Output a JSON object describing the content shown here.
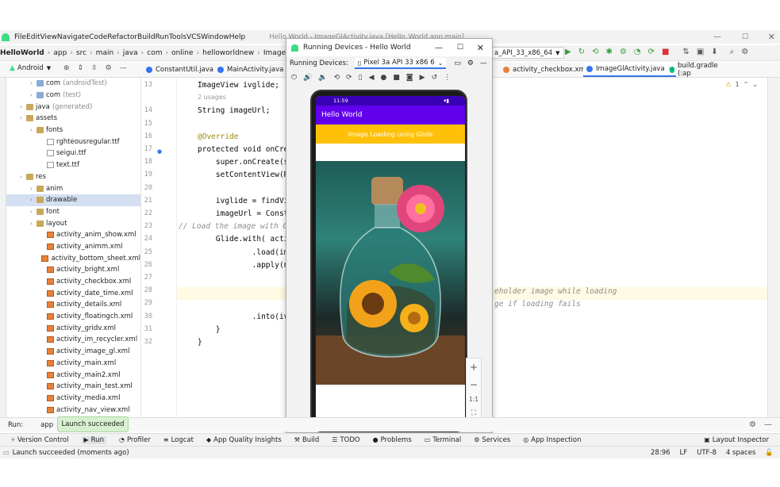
{
  "menu": [
    "File",
    "Edit",
    "View",
    "Navigate",
    "Code",
    "Refactor",
    "Build",
    "Run",
    "Tools",
    "VCS",
    "Window",
    "Help"
  ],
  "window_title": "Hello World - ImageGlActivity.java [Hello_World.app.main]",
  "breadcrumb": [
    "HelloWorld",
    "app",
    "src",
    "main",
    "java",
    "com",
    "online",
    "helloworldnew",
    "ImageGlActi"
  ],
  "device_selector": "a_API_33_x86_64",
  "project_view": "Android",
  "editor_tabs": [
    {
      "label": "ConstantUtil.java"
    },
    {
      "label": "MainActivity.java"
    },
    {
      "label": "activity_checkbox.xml"
    },
    {
      "label": "ImageGlActivity.java",
      "active": true
    },
    {
      "label": "build.gradle (:ap"
    }
  ],
  "warning_count": "1",
  "tree": [
    {
      "label": "com",
      "suffix": "(androidTest)",
      "indent": 2,
      "type": "folder-blue"
    },
    {
      "label": "com",
      "suffix": "(test)",
      "indent": 2,
      "type": "folder-blue"
    },
    {
      "label": "java",
      "suffix": "(generated)",
      "indent": 1,
      "type": "folder"
    },
    {
      "label": "assets",
      "indent": 1,
      "type": "folder"
    },
    {
      "label": "fonts",
      "indent": 2,
      "type": "folder"
    },
    {
      "label": "rghteousregular.ttf",
      "indent": 3,
      "type": "file"
    },
    {
      "label": "seigui.ttf",
      "indent": 3,
      "type": "file"
    },
    {
      "label": "text.ttf",
      "indent": 3,
      "type": "file"
    },
    {
      "label": "res",
      "indent": 1,
      "type": "folder"
    },
    {
      "label": "anim",
      "indent": 2,
      "type": "folder"
    },
    {
      "label": "drawable",
      "indent": 2,
      "type": "folder",
      "selected": true
    },
    {
      "label": "font",
      "indent": 2,
      "type": "folder"
    },
    {
      "label": "layout",
      "indent": 2,
      "type": "folder"
    },
    {
      "label": "activity_anim_show.xml",
      "indent": 3,
      "type": "xml"
    },
    {
      "label": "activity_animm.xml",
      "indent": 3,
      "type": "xml"
    },
    {
      "label": "activity_bottom_sheet.xml",
      "indent": 3,
      "type": "xml"
    },
    {
      "label": "activity_bright.xml",
      "indent": 3,
      "type": "xml"
    },
    {
      "label": "activity_checkbox.xml",
      "indent": 3,
      "type": "xml"
    },
    {
      "label": "activity_date_time.xml",
      "indent": 3,
      "type": "xml"
    },
    {
      "label": "activity_details.xml",
      "indent": 3,
      "type": "xml"
    },
    {
      "label": "activity_floatingch.xml",
      "indent": 3,
      "type": "xml"
    },
    {
      "label": "activity_gridv.xml",
      "indent": 3,
      "type": "xml"
    },
    {
      "label": "activity_im_recycler.xml",
      "indent": 3,
      "type": "xml"
    },
    {
      "label": "activity_image_gl.xml",
      "indent": 3,
      "type": "xml"
    },
    {
      "label": "activity_main.xml",
      "indent": 3,
      "type": "xml"
    },
    {
      "label": "activity_main2.xml",
      "indent": 3,
      "type": "xml"
    },
    {
      "label": "activity_main_test.xml",
      "indent": 3,
      "type": "xml"
    },
    {
      "label": "activity_media.xml",
      "indent": 3,
      "type": "xml"
    },
    {
      "label": "activity_nav_view.xml",
      "indent": 3,
      "type": "xml"
    }
  ],
  "code_lines": [
    {
      "n": "13",
      "text": "ImageView ivglide;"
    },
    {
      "n": "",
      "text": "2 usages",
      "hint": true
    },
    {
      "n": "14",
      "text": "String imageUrl;"
    },
    {
      "n": "15",
      "text": ""
    },
    {
      "n": "16",
      "text": "@Override",
      "ann": true
    },
    {
      "n": "17",
      "text": "protected void onCre"
    },
    {
      "n": "18",
      "text": "    super.onCreate(s"
    },
    {
      "n": "19",
      "text": "    setContentView(R"
    },
    {
      "n": "20",
      "text": ""
    },
    {
      "n": "21",
      "text": "    ivglide = findVi"
    },
    {
      "n": "22",
      "text": "    imageUrl = Const"
    },
    {
      "n": "23",
      "text": "// Load the image with G",
      "comment": true
    },
    {
      "n": "24",
      "text": "    Glide.with( activi"
    },
    {
      "n": "25",
      "text": "            .load(im"
    },
    {
      "n": "26",
      "text": "            .apply(n"
    },
    {
      "n": "27",
      "text": ""
    },
    {
      "n": "28",
      "text": ""
    },
    {
      "n": "29",
      "text": ""
    },
    {
      "n": "30",
      "text": "            .into(iv"
    },
    {
      "n": "31",
      "text": "    }"
    },
    {
      "n": "32",
      "text": "}"
    }
  ],
  "code_right": {
    "line28": "eholder image while loading",
    "line29": "ge if loading fails"
  },
  "running_devices": {
    "title": "Running Devices - Hello World",
    "label": "Running Devices:",
    "device": "Pixel 3a API 33 x86 6",
    "zoom_label": "1:1"
  },
  "phone": {
    "time": "11:59",
    "app_title": "Hello World",
    "button": "Image Loading using Glide"
  },
  "run_bar": {
    "label": "Run:",
    "config": "app",
    "toast": "Launch succeeded"
  },
  "tool_windows": [
    "Version Control",
    "Run",
    "Profiler",
    "Logcat",
    "App Quality Insights",
    "Build",
    "TODO",
    "Problems",
    "Terminal",
    "Services",
    "App Inspection"
  ],
  "layout_inspector": "Layout Inspector",
  "status": {
    "message": "Launch succeeded (moments ago)",
    "position": "28:96",
    "line_sep": "LF",
    "encoding": "UTF-8",
    "indent": "4 spaces"
  }
}
